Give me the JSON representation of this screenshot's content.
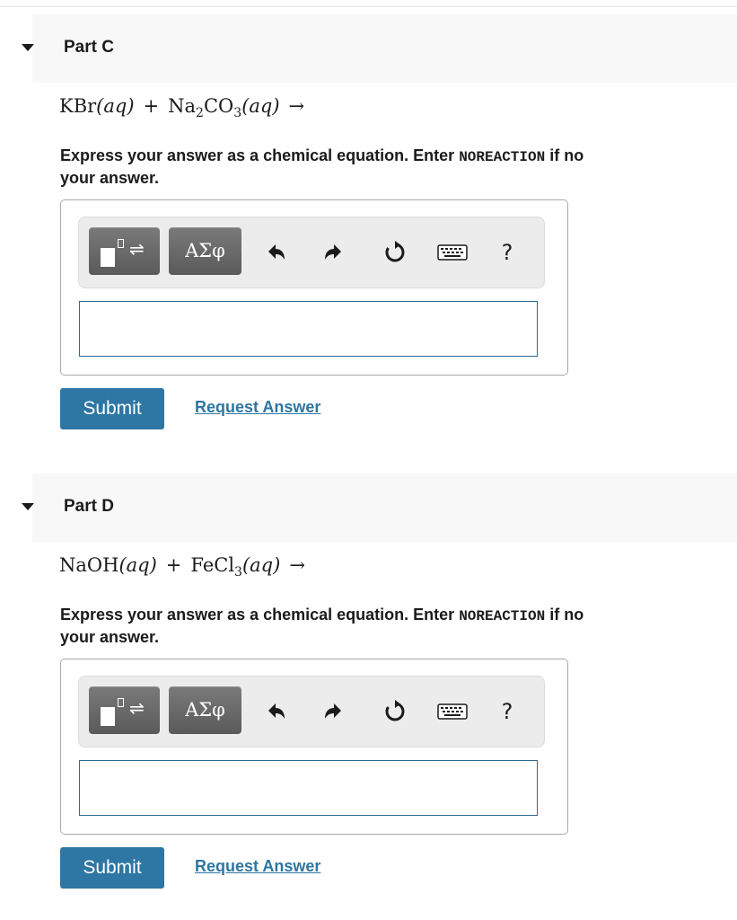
{
  "parts": [
    {
      "title": "Part C",
      "equation": {
        "reactant1_formula": "KBr",
        "reactant1_state": "(aq)",
        "plus": "+",
        "reactant2_na": "Na",
        "reactant2_na_sub": "2",
        "reactant2_co": "CO",
        "reactant2_co_sub": "3",
        "reactant2_state": "(aq)",
        "arrow": "→"
      },
      "instruction_line1_a": "Express your answer as a chemical equation. Enter ",
      "instruction_keyword": "NOREACTION",
      "instruction_line1_b": " if no",
      "instruction_line2": "your answer.",
      "toolbar": {
        "greek_label": "ΑΣφ",
        "help_label": "?"
      },
      "answer_value": "",
      "submit_label": "Submit",
      "request_label": "Request Answer"
    },
    {
      "title": "Part D",
      "equation": {
        "reactant1_formula": "NaOH",
        "reactant1_state": "(aq)",
        "plus": "+",
        "reactant2_fe": "FeCl",
        "reactant2_fe_sub": "3",
        "reactant2_state": "(aq)",
        "arrow": "→"
      },
      "instruction_line1_a": "Express your answer as a chemical equation. Enter ",
      "instruction_keyword": "NOREACTION",
      "instruction_line1_b": " if no",
      "instruction_line2": "your answer.",
      "toolbar": {
        "greek_label": "ΑΣφ",
        "help_label": "?"
      },
      "answer_value": "",
      "submit_label": "Submit",
      "request_label": "Request Answer"
    }
  ],
  "icons": [
    "chevron-down-icon",
    "templates-icon",
    "undo-icon",
    "redo-icon",
    "reset-icon",
    "keyboard-icon",
    "help-icon"
  ],
  "colors": {
    "accent": "#2e76a3",
    "header_bg": "#f8f8f8",
    "toolbar_bg": "#ececec",
    "dark_button": "#6a6a6a"
  }
}
